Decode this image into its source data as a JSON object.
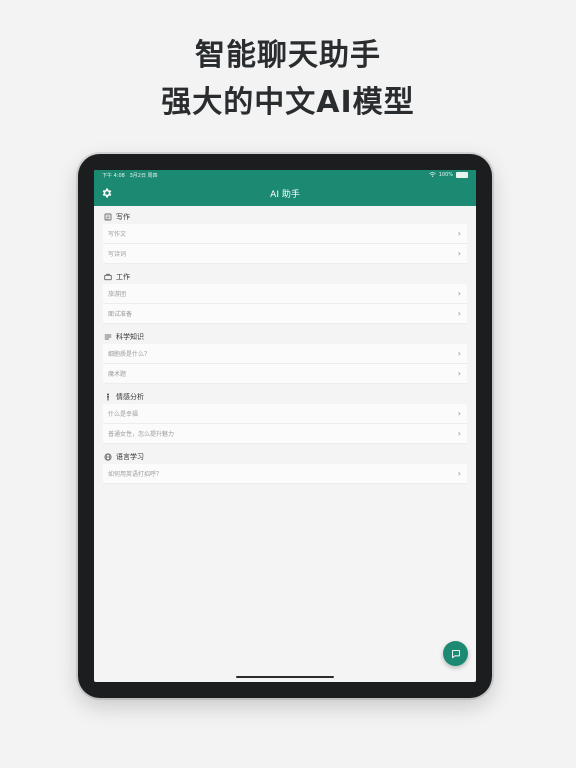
{
  "headline": {
    "line1": "智能聊天助手",
    "line2": "强大的中文AI模型"
  },
  "statusbar": {
    "time": "下午 4:08",
    "date": "3月2日 周四",
    "battery": "100%"
  },
  "appbar": {
    "title": "AI 助手"
  },
  "sections": [
    {
      "title": "写作",
      "icon": "document-icon",
      "items": [
        "写作文",
        "写诗词"
      ]
    },
    {
      "title": "工作",
      "icon": "briefcase-icon",
      "items": [
        "旅游团",
        "面试准备"
      ]
    },
    {
      "title": "科学知识",
      "icon": "lines-icon",
      "items": [
        "细胞质是什么？",
        "魔术题"
      ]
    },
    {
      "title": "情感分析",
      "icon": "person-icon",
      "items": [
        "什么是幸福",
        "普通女性，怎么提升魅力"
      ]
    },
    {
      "title": "语言学习",
      "icon": "globe-icon",
      "items": [
        "如何用英语打招呼？"
      ]
    }
  ],
  "colors": {
    "accent": "#1c8a73",
    "background": "#f3f3f3",
    "device": "#1b1d1e"
  },
  "icons": {
    "settings": "gear-icon",
    "fab": "chat-icon",
    "row_chevron": "chevron-right-icon"
  }
}
